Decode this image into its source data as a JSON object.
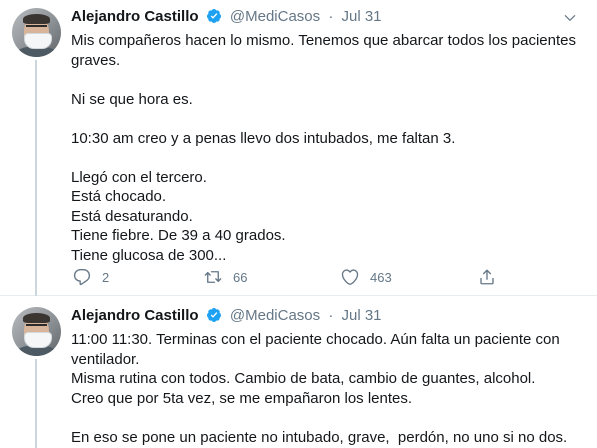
{
  "tweets": [
    {
      "author": {
        "name": "Alejandro Castillo",
        "handle": "@MediCasos",
        "verified": true
      },
      "separator": "·",
      "date": "Jul 31",
      "paragraphs": [
        "Mis compañeros hacen lo mismo. Tenemos que abarcar todos los pacientes graves.",
        "Ni se que hora es.",
        "10:30 am creo y a penas llevo dos intubados, me faltan 3.",
        "Llegó con el tercero.\nEstá chocado.\nEstá desaturando.\nTiene fiebre. De 39 a 40 grados.\nTiene glucosa de 300..."
      ],
      "stats": {
        "replies": "2",
        "retweets": "66",
        "likes": "463"
      }
    },
    {
      "author": {
        "name": "Alejandro Castillo",
        "handle": "@MediCasos",
        "verified": true
      },
      "separator": "·",
      "date": "Jul 31",
      "paragraphs": [
        "11:00 11:30. Terminas con el paciente chocado. Aún falta un paciente con ventilador.\nMisma rutina con todos. Cambio de bata, cambio de guantes, alcohol.\nCreo que por 5ta vez, se me empañaron los lentes.",
        "En eso se pone un paciente no intubado, grave,  perdón, no uno si no dos."
      ]
    }
  ],
  "icons": {
    "verified": "verified-badge-icon",
    "caret": "chevron-down-icon",
    "reply": "reply-icon",
    "retweet": "retweet-icon",
    "like": "heart-icon",
    "share": "share-icon"
  },
  "colors": {
    "text": "#14171a",
    "secondary": "#657786",
    "verified": "#1da1f2",
    "divider": "#e6ecf0",
    "thread_line": "#ccd6dd"
  }
}
